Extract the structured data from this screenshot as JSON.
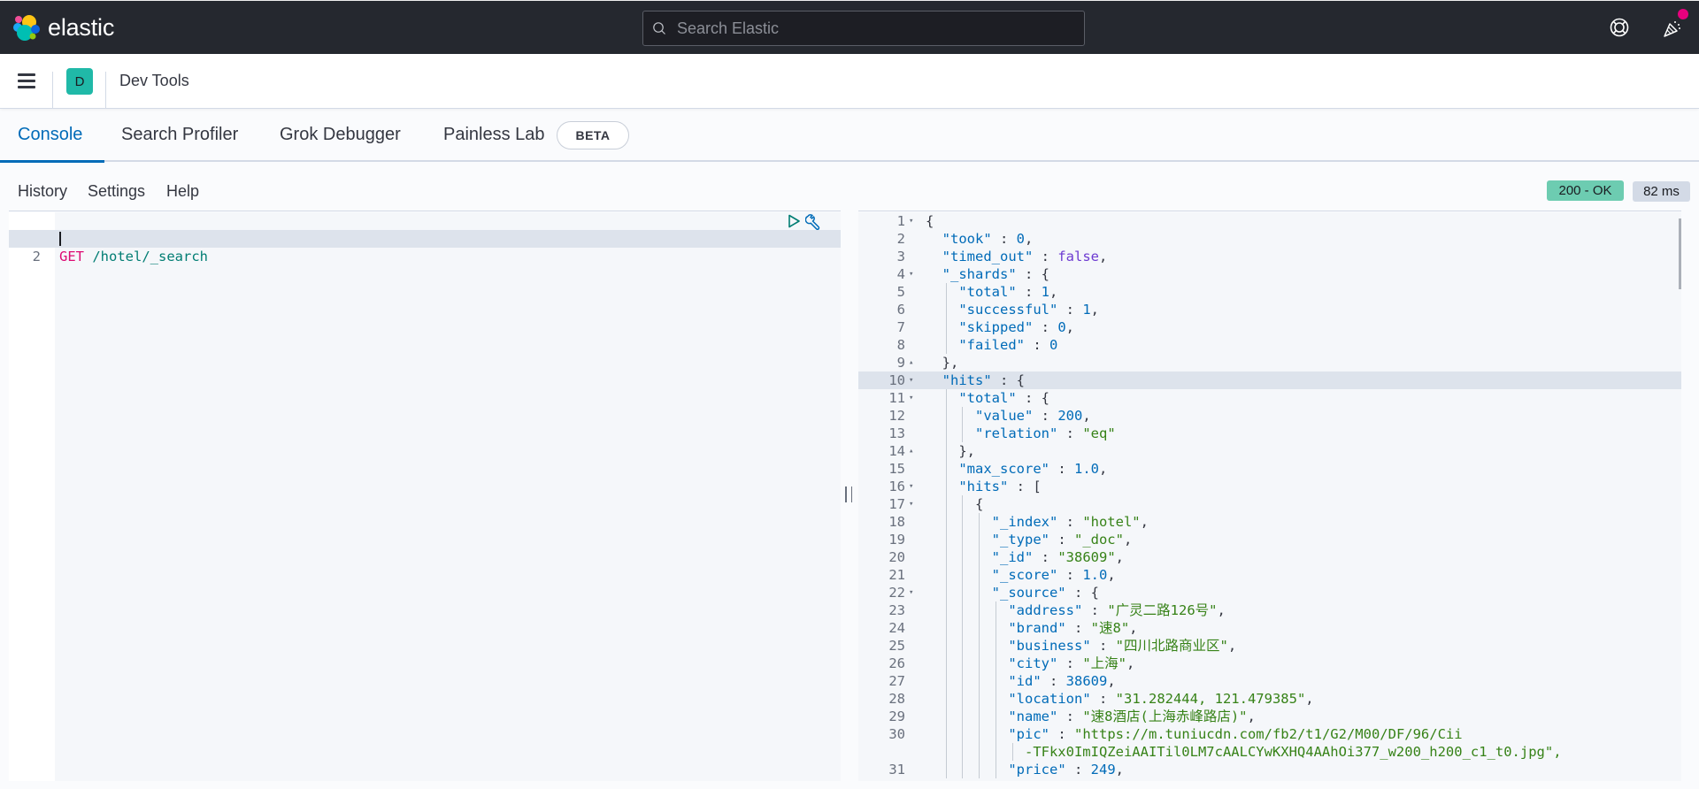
{
  "header": {
    "brand": "elastic",
    "search_placeholder": "Search Elastic",
    "icons": [
      "help-icon",
      "newsfeed-icon"
    ],
    "notification_dot_color": "#e7007e"
  },
  "appbar": {
    "avatar_letter": "D",
    "title": "Dev Tools"
  },
  "tabs": [
    {
      "label": "Console",
      "active": true
    },
    {
      "label": "Search Profiler",
      "active": false
    },
    {
      "label": "Grok Debugger",
      "active": false
    },
    {
      "label": "Painless Lab",
      "active": false,
      "badge": "BETA"
    }
  ],
  "toolbar": {
    "history": "History",
    "settings": "Settings",
    "help": "Help",
    "status": "200 - OK",
    "time": "82 ms"
  },
  "request": {
    "method": "GET",
    "path": "/hotel/_search"
  },
  "response_lines": [
    {
      "n": "1",
      "fold": "▾",
      "t": "{"
    },
    {
      "n": "2",
      "t": "  \"took\" : 0,"
    },
    {
      "n": "3",
      "t": "  \"timed_out\" : false,"
    },
    {
      "n": "4",
      "fold": "▾",
      "t": "  \"_shards\" : {"
    },
    {
      "n": "5",
      "t": "    \"total\" : 1,"
    },
    {
      "n": "6",
      "t": "    \"successful\" : 1,"
    },
    {
      "n": "7",
      "t": "    \"skipped\" : 0,"
    },
    {
      "n": "8",
      "t": "    \"failed\" : 0"
    },
    {
      "n": "9",
      "fold": "▴",
      "t": "  },"
    },
    {
      "n": "10",
      "fold": "▾",
      "t": "  \"hits\" : {",
      "hl": true
    },
    {
      "n": "11",
      "fold": "▾",
      "t": "    \"total\" : {"
    },
    {
      "n": "12",
      "t": "      \"value\" : 200,"
    },
    {
      "n": "13",
      "t": "      \"relation\" : \"eq\""
    },
    {
      "n": "14",
      "fold": "▴",
      "t": "    },"
    },
    {
      "n": "15",
      "t": "    \"max_score\" : 1.0,"
    },
    {
      "n": "16",
      "fold": "▾",
      "t": "    \"hits\" : ["
    },
    {
      "n": "17",
      "fold": "▾",
      "t": "      {"
    },
    {
      "n": "18",
      "t": "        \"_index\" : \"hotel\","
    },
    {
      "n": "19",
      "t": "        \"_type\" : \"_doc\","
    },
    {
      "n": "20",
      "t": "        \"_id\" : \"38609\","
    },
    {
      "n": "21",
      "t": "        \"_score\" : 1.0,"
    },
    {
      "n": "22",
      "fold": "▾",
      "t": "        \"_source\" : {"
    },
    {
      "n": "23",
      "t": "          \"address\" : \"广灵二路126号\","
    },
    {
      "n": "24",
      "t": "          \"brand\" : \"速8\","
    },
    {
      "n": "25",
      "t": "          \"business\" : \"四川北路商业区\","
    },
    {
      "n": "26",
      "t": "          \"city\" : \"上海\","
    },
    {
      "n": "27",
      "t": "          \"id\" : 38609,"
    },
    {
      "n": "28",
      "t": "          \"location\" : \"31.282444, 121.479385\","
    },
    {
      "n": "29",
      "t": "          \"name\" : \"速8酒店(上海赤峰路店)\","
    },
    {
      "n": "30",
      "t": "          \"pic\" : \"https://m.tuniucdn.com/fb2/t1/G2/M00/DF/96/Cii"
    },
    {
      "n": "",
      "t": "            -TFkx0ImIQZeiAAITil0LM7cAALCYwKXHQ4AAhOi377_w200_h200_c1_t0.jpg\","
    },
    {
      "n": "31",
      "t": "          \"price\" : 249,"
    }
  ]
}
